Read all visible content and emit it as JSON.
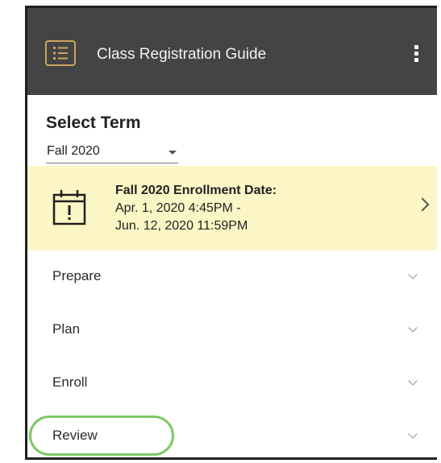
{
  "header": {
    "title": "Class Registration Guide",
    "icon": "list-icon",
    "menu_icon": "more-vertical-icon",
    "background": "#444444",
    "icon_accent": "#c9a55c"
  },
  "term": {
    "heading": "Select Term",
    "selected": "Fall 2020"
  },
  "enrollment": {
    "icon": "calendar-alert-icon",
    "heading": "Fall 2020 Enrollment Date:",
    "start": "Apr. 1, 2020 4:45PM -",
    "end": "Jun. 12, 2020 11:59PM",
    "background": "#fcf5c5"
  },
  "sections": [
    {
      "label": "Prepare"
    },
    {
      "label": "Plan"
    },
    {
      "label": "Enroll"
    },
    {
      "label": "Review",
      "highlighted": true
    }
  ],
  "highlight_color": "#7ec865"
}
